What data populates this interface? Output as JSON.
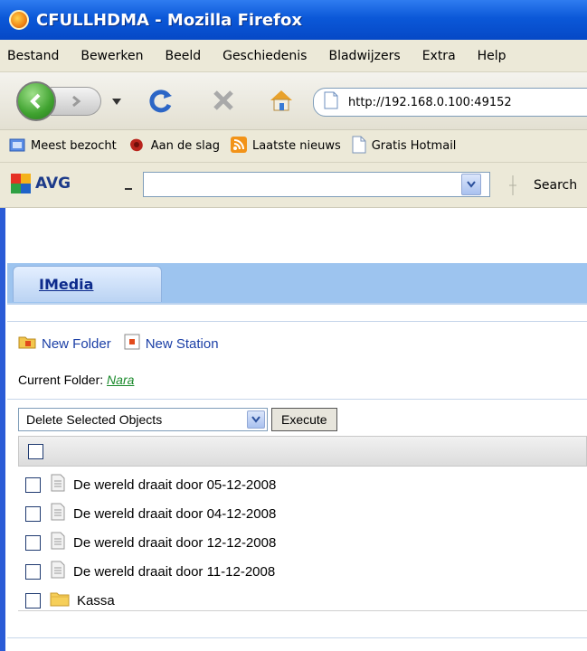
{
  "window": {
    "title": "CFULLHDMA - Mozilla Firefox"
  },
  "menubar": {
    "items": [
      {
        "label": "Bestand"
      },
      {
        "label": "Bewerken"
      },
      {
        "label": "Beeld"
      },
      {
        "label": "Geschiedenis"
      },
      {
        "label": "Bladwijzers"
      },
      {
        "label": "Extra"
      },
      {
        "label": "Help"
      }
    ]
  },
  "navbar": {
    "url": "http://192.168.0.100:49152"
  },
  "bookmarks": {
    "items": [
      {
        "label": "Meest bezocht",
        "icon": "folder-icon"
      },
      {
        "label": "Aan de slag",
        "icon": "firefox-icon"
      },
      {
        "label": "Laatste nieuws",
        "icon": "rss-icon"
      },
      {
        "label": "Gratis Hotmail",
        "icon": "page-icon"
      }
    ]
  },
  "avgbar": {
    "logo_text": "AVG",
    "search_value": "",
    "search_label": "Search"
  },
  "page": {
    "tab_label": "IMedia",
    "actions": {
      "new_folder": "New Folder",
      "new_station": "New Station"
    },
    "current_folder_label": "Current Folder:",
    "current_folder_value": "Nara",
    "bulk_action_selected": "Delete Selected Objects",
    "execute_label": "Execute",
    "items": [
      {
        "label": "De wereld draait door 05-12-2008",
        "type": "station"
      },
      {
        "label": "De wereld draait door 04-12-2008",
        "type": "station"
      },
      {
        "label": "De wereld draait door 12-12-2008",
        "type": "station"
      },
      {
        "label": "De wereld draait door 11-12-2008",
        "type": "station"
      },
      {
        "label": "Kassa",
        "type": "folder"
      }
    ]
  },
  "colors": {
    "titlebar": "#0b58d8",
    "tab_band": "#9dc4ef",
    "link_blue": "#1b3fa6",
    "folder_link_green": "#1a8a2b"
  }
}
